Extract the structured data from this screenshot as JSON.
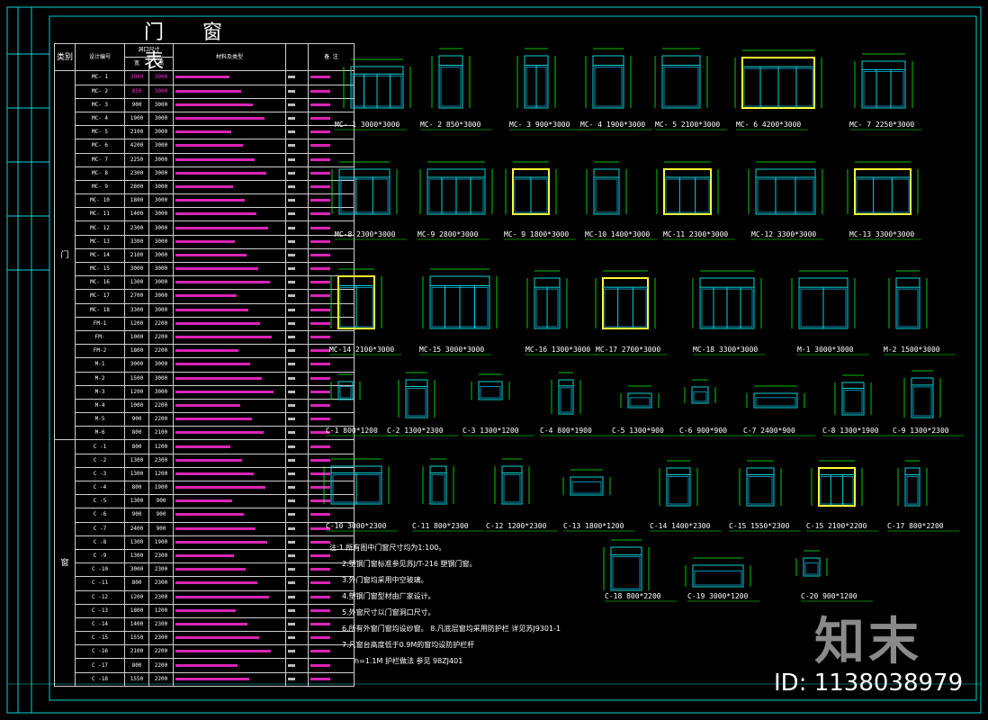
{
  "title": "门 窗 表",
  "table": {
    "header": {
      "type": "类别",
      "id": "设计编号",
      "size": "洞口尺寸",
      "w": "宽",
      "h": "高",
      "material": "材料及类型",
      "note": "备 注"
    },
    "door_group": "门",
    "window_group": "窗",
    "rows": [
      {
        "id": "MC- 1",
        "w": "3000",
        "h": "3000"
      },
      {
        "id": "MC- 2",
        "w": "850",
        "h": "3000"
      },
      {
        "id": "MC- 3",
        "w": "900",
        "h": "3000"
      },
      {
        "id": "MC- 4",
        "w": "1900",
        "h": "3000"
      },
      {
        "id": "MC- 5",
        "w": "2100",
        "h": "3000"
      },
      {
        "id": "MC- 6",
        "w": "4200",
        "h": "3000"
      },
      {
        "id": "MC- 7",
        "w": "2250",
        "h": "3000"
      },
      {
        "id": "MC- 8",
        "w": "2300",
        "h": "3000"
      },
      {
        "id": "MC- 9",
        "w": "2800",
        "h": "3000"
      },
      {
        "id": "MC- 10",
        "w": "1800",
        "h": "3000"
      },
      {
        "id": "MC- 11",
        "w": "1400",
        "h": "3000"
      },
      {
        "id": "MC- 12",
        "w": "2300",
        "h": "3000"
      },
      {
        "id": "MC- 13",
        "w": "3300",
        "h": "3000"
      },
      {
        "id": "MC- 14",
        "w": "2100",
        "h": "3000"
      },
      {
        "id": "MC- 15",
        "w": "3000",
        "h": "3000"
      },
      {
        "id": "MC- 16",
        "w": "1300",
        "h": "3000"
      },
      {
        "id": "MC- 17",
        "w": "2700",
        "h": "3000"
      },
      {
        "id": "MC- 18",
        "w": "3300",
        "h": "3000"
      },
      {
        "id": "FM-1",
        "w": "1200",
        "h": "2200"
      },
      {
        "id": "FM-",
        "w": "1000",
        "h": "2200"
      },
      {
        "id": "FM-2",
        "w": "1800",
        "h": "2200"
      },
      {
        "id": "M-1",
        "w": "3000",
        "h": "3000"
      },
      {
        "id": "M-2",
        "w": "1500",
        "h": "3000"
      },
      {
        "id": "M-3",
        "w": "1200",
        "h": "3000"
      },
      {
        "id": "M-4",
        "w": "1000",
        "h": "2200"
      },
      {
        "id": "M-5",
        "w": "900",
        "h": "2200"
      },
      {
        "id": "M-6",
        "w": "800",
        "h": "2100"
      },
      {
        "id": "C -1",
        "w": "800",
        "h": "1200"
      },
      {
        "id": "C -2",
        "w": "1300",
        "h": "2300"
      },
      {
        "id": "C -3",
        "w": "1300",
        "h": "1200"
      },
      {
        "id": "C -4",
        "w": "800",
        "h": "1900"
      },
      {
        "id": "C -5",
        "w": "1300",
        "h": "900"
      },
      {
        "id": "C -6",
        "w": "900",
        "h": "900"
      },
      {
        "id": "C -7",
        "w": "2400",
        "h": "900"
      },
      {
        "id": "C -8",
        "w": "1300",
        "h": "1900"
      },
      {
        "id": "C -9",
        "w": "1300",
        "h": "2300"
      },
      {
        "id": "C -10",
        "w": "3000",
        "h": "2300"
      },
      {
        "id": "C -11",
        "w": "800",
        "h": "2300"
      },
      {
        "id": "C -12",
        "w": "1200",
        "h": "2300"
      },
      {
        "id": "C -13",
        "w": "1800",
        "h": "1200"
      },
      {
        "id": "C -14",
        "w": "1400",
        "h": "2300"
      },
      {
        "id": "C -15",
        "w": "1550",
        "h": "2300"
      },
      {
        "id": "C -16",
        "w": "2100",
        "h": "2200"
      },
      {
        "id": "C -17",
        "w": "800",
        "h": "2200"
      },
      {
        "id": "C -18",
        "w": "1550",
        "h": "2200"
      }
    ]
  },
  "elevations": [
    {
      "label": "MC- 1  3000*3000"
    },
    {
      "label": "MC- 2  850*3000"
    },
    {
      "label": "MC- 3  900*3000"
    },
    {
      "label": "MC- 4  1900*3000"
    },
    {
      "label": "MC- 5  2100*3000"
    },
    {
      "label": "MC- 6  4200*3000"
    },
    {
      "label": "MC- 7  2250*3000"
    },
    {
      "label": "MC-8  2300*3000"
    },
    {
      "label": "MC-9  2800*3000"
    },
    {
      "label": "MC- 9  1800*3000"
    },
    {
      "label": "MC-10  1400*3000"
    },
    {
      "label": "MC-11  2300*3000"
    },
    {
      "label": "MC-12  3300*3000"
    },
    {
      "label": "MC-13  3300*3000"
    },
    {
      "label": "MC-14  2100*3000"
    },
    {
      "label": "MC-15  3000*3000"
    },
    {
      "label": "MC-16  1300*3000"
    },
    {
      "label": "MC-17  2700*3000"
    },
    {
      "label": "MC-18  3300*3000"
    },
    {
      "label": "M-1  3000*3000"
    },
    {
      "label": "M-2  1500*3000"
    },
    {
      "label": "C-1  800*1200"
    },
    {
      "label": "C-2  1300*2300"
    },
    {
      "label": "C-3  1300*1200"
    },
    {
      "label": "C-4  800*1900"
    },
    {
      "label": "C-5  1300*900"
    },
    {
      "label": "C-6  900*900"
    },
    {
      "label": "C-7  2400*900"
    },
    {
      "label": "C-8  1300*1900"
    },
    {
      "label": "C-9  1300*2300"
    },
    {
      "label": "C-10  3000*2300"
    },
    {
      "label": "C-11  800*2300"
    },
    {
      "label": "C-12  1200*2300"
    },
    {
      "label": "C-13  1800*1200"
    },
    {
      "label": "C-14  1400*2300"
    },
    {
      "label": "C-15  1550*2300"
    },
    {
      "label": "C-15  2100*2200"
    },
    {
      "label": "C-17  800*2200"
    },
    {
      "label": "C-18  800*2200"
    },
    {
      "label": "C-19  3000*1200"
    },
    {
      "label": "C-20  900*1200"
    }
  ],
  "notes": [
    "注:1.所有图中门窗尺寸均为1:100。",
    "2.塑钢门窗标准参见苏J/T-216  塑钢门窗。",
    "3.外门窗均采用中空玻璃。",
    "4.塑钢门窗型材由厂家设计。",
    "5.外窗尺寸以门窗洞口尺寸。",
    "6.所有外窗门窗均设纱窗。  8.凡底层窗均采用防护栏 详见苏J9301-1",
    "7.凡窗台高度低于0.9M的窗均设防护栏杆",
    "h=1.1M 护栏做法    参见 98ZJ401"
  ],
  "watermark": {
    "brand": "知末",
    "id": "ID: 1138038979"
  },
  "colors": {
    "frame": "#00d5d5",
    "dimension": "#00ff00",
    "glass": "#00c8ff",
    "highlight": "#ffff33",
    "accent": "#ff2bd6"
  }
}
